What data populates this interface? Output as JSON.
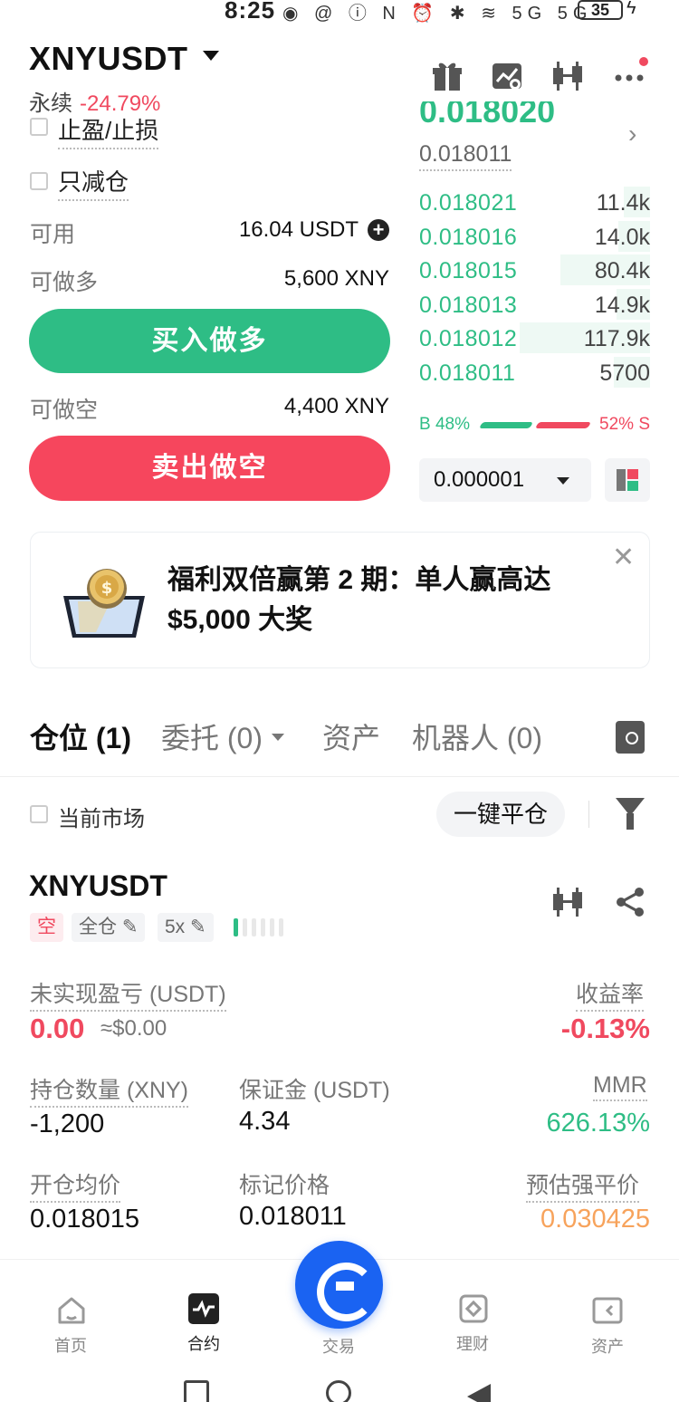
{
  "status_bar": {
    "time": "8:25",
    "icons": "◉ @   ⓘ N ⏰ ✱ ≋ 5G 5G",
    "battery": "35"
  },
  "header": {
    "symbol": "XNYUSDT",
    "contract_type": "永续",
    "change": "-24.79%",
    "icons": [
      "gift-icon",
      "chart-icon",
      "candlestick-icon",
      "more-icon"
    ]
  },
  "order_form": {
    "tp_sl_label": "止盈/止损",
    "reduce_only_label": "只减仓",
    "available_label": "可用",
    "available_value": "16.04 USDT",
    "can_long_label": "可做多",
    "can_long_value": "5,600 XNY",
    "buy_long_button": "买入做多",
    "can_short_label": "可做空",
    "can_short_value": "4,400 XNY",
    "sell_short_button": "卖出做空"
  },
  "orderbook": {
    "last_price_partial": "0.018020",
    "mark_price": "0.018011",
    "bids": [
      {
        "price": "0.018021",
        "qty": "11.4k",
        "depth": 0.18
      },
      {
        "price": "0.018016",
        "qty": "14.0k",
        "depth": 0.22
      },
      {
        "price": "0.018015",
        "qty": "80.4k",
        "depth": 0.62
      },
      {
        "price": "0.018013",
        "qty": "14.9k",
        "depth": 0.23
      },
      {
        "price": "0.018012",
        "qty": "117.9k",
        "depth": 0.9
      },
      {
        "price": "0.018011",
        "qty": "5700",
        "depth": 0.25
      }
    ],
    "buy_ratio": "B 48%",
    "sell_ratio": "52% S",
    "precision": "0.000001"
  },
  "promo": {
    "text": "福利双倍赢第 2 期：单人赢高达 $5,000 大奖"
  },
  "tabs": [
    {
      "label": "仓位 (1)",
      "active": true
    },
    {
      "label": "委托 (0)",
      "active": false
    },
    {
      "label": "资产",
      "active": false
    },
    {
      "label": "机器人 (0)",
      "active": false
    }
  ],
  "filters": {
    "current_market": "当前市场",
    "close_all": "一键平仓"
  },
  "position": {
    "symbol": "XNYUSDT",
    "side_tag": "空",
    "margin_mode_tag": "全仓",
    "leverage_tag": "5x",
    "unrealized_pnl_label": "未实现盈亏 (USDT)",
    "unrealized_pnl_value": "0.00",
    "unrealized_pnl_usd": "≈$0.00",
    "roe_label": "收益率",
    "roe_value": "-0.13%",
    "size_label": "持仓数量 (XNY)",
    "size_value": "-1,200",
    "margin_label": "保证金 (USDT)",
    "margin_value": "4.34",
    "mmr_label": "MMR",
    "mmr_value": "626.13%",
    "entry_label": "开仓均价",
    "entry_value": "0.018015",
    "mark_label": "标记价格",
    "mark_value": "0.018011",
    "liq_label": "预估强平价",
    "liq_value": "0.030425"
  },
  "bottom_nav": [
    {
      "label": "首页",
      "icon": "home-icon"
    },
    {
      "label": "合约",
      "icon": "futures-icon"
    },
    {
      "label": "交易",
      "icon": "trade-icon"
    },
    {
      "label": "理财",
      "icon": "earn-icon"
    },
    {
      "label": "资产",
      "icon": "wallet-icon"
    }
  ],
  "colors": {
    "green": "#2ebd85",
    "red": "#f6465d",
    "blue": "#1a63f2",
    "orange": "#f7a35c"
  }
}
